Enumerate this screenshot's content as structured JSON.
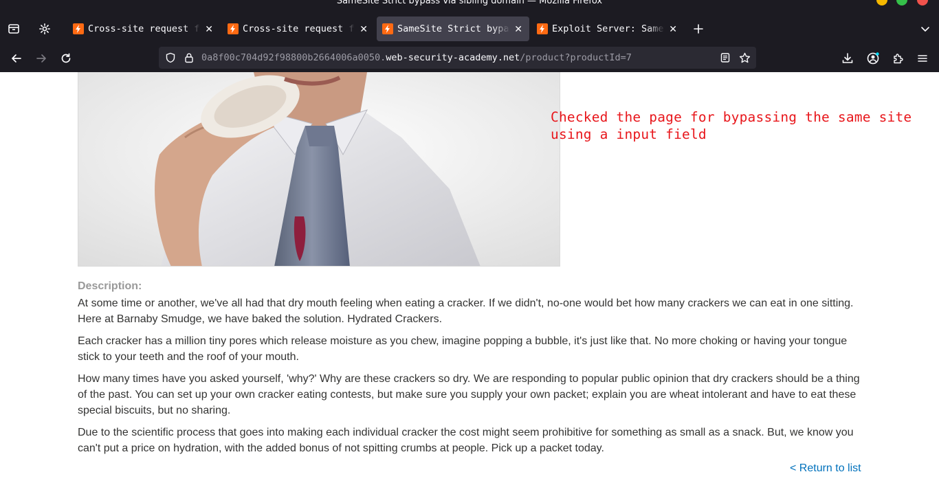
{
  "window": {
    "title": "SameSite Strict bypass via sibling domain — Mozilla Firefox"
  },
  "tabs": [
    {
      "label": "Cross-site request forgery",
      "active": false
    },
    {
      "label": "Cross-site request forgery",
      "active": false
    },
    {
      "label": "SameSite Strict bypass via sibling domain",
      "active": true
    },
    {
      "label": "Exploit Server: SameSite Strict bypass",
      "active": false
    }
  ],
  "address_bar": {
    "url_prefix": "0a8f00c704d92f98800b2664006a0050.",
    "url_host": "web-security-academy.net",
    "url_path": "/product?productId=7"
  },
  "annotation": {
    "line1": "Checked the page for bypassing the same site",
    "line2": "using a input field"
  },
  "product": {
    "description_label": "Description:",
    "paragraphs": [
      "At some time or another, we've all had that dry mouth feeling when eating a cracker. If we didn't, no-one would bet how many crackers we can eat in one sitting. Here at Barnaby Smudge, we have baked the solution. Hydrated Crackers.",
      "Each cracker has a million tiny pores which release moisture as you chew, imagine popping a bubble, it's just like that. No more choking or having your tongue stick to your teeth and the roof of your mouth.",
      "How many times have you asked yourself, 'why?' Why are these crackers so dry. We are responding to popular public opinion that dry crackers should be a thing of the past. You can set up your own cracker eating contests, but make sure you supply your own packet; explain you are wheat intolerant and have to eat these special biscuits, but no sharing.",
      "Due to the scientific process that goes into making each individual cracker the cost might seem prohibitive for something as small as a snack. But, we know you can't put a price on hydration, with the added bonus of not spitting crumbs at people. Pick up a packet today."
    ],
    "return_link": "< Return to list"
  },
  "colors": {
    "chrome_bg": "#1c1b22",
    "active_tab": "#42414d",
    "urlbar_bg": "#2b2a33",
    "favicon": "#ff6a13",
    "annotation": "#e8161b",
    "link": "#0071bc",
    "label_gray": "#999999",
    "body_text": "#333332"
  }
}
